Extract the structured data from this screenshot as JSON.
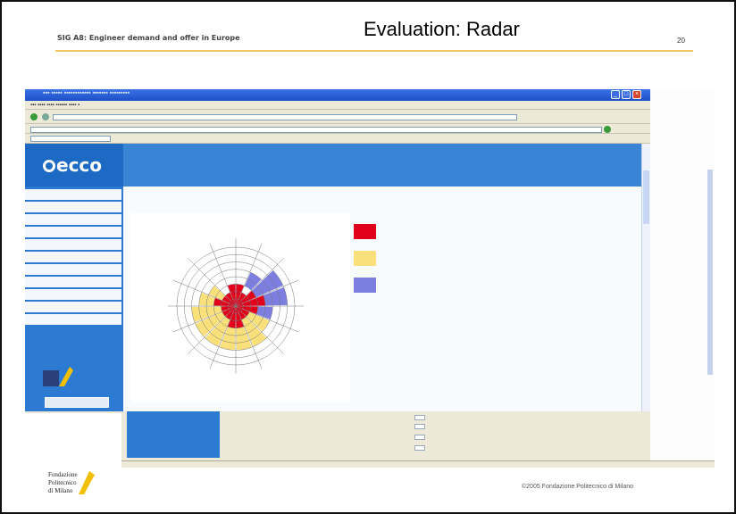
{
  "slide": {
    "header_left": "SIG A8: Engineer demand and offer in Europe",
    "title": "Evaluation: Radar",
    "page_number": "20",
    "copyright": "©2005 Fondazione Politecnico di Milano",
    "accent_color": "#f2c75c"
  },
  "screenshot": {
    "logo_text": "ecco",
    "content_title": "",
    "sidebar_items": [
      "",
      "",
      "",
      "",
      "",
      "",
      "",
      "",
      "",
      "",
      ""
    ],
    "legend": [
      {
        "color": "#e0001b",
        "text": ""
      },
      {
        "color": "#f9e07a",
        "text": ""
      },
      {
        "color": "#7d7fe0",
        "text": ""
      }
    ],
    "colors": {
      "banner": "#1d6ac4",
      "sidebar": "#2d7ad3",
      "radar_red": "#e0001b",
      "radar_yellow": "#f9e07a",
      "radar_blue": "#7d7fe0"
    }
  }
}
